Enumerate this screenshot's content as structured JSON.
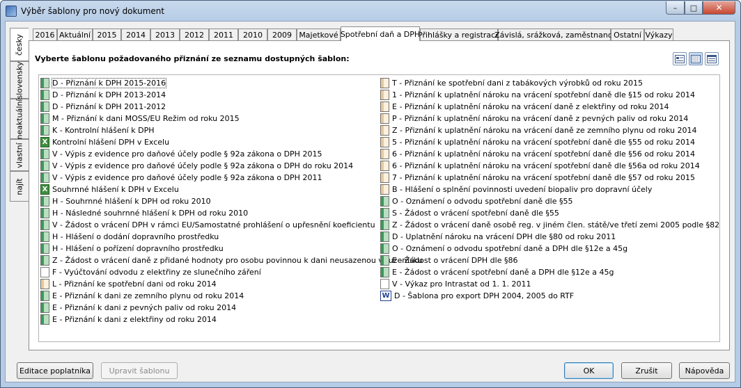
{
  "window": {
    "title": "Výběr šablony pro nový dokument",
    "min_glyph": "–",
    "max_glyph": "□",
    "close_glyph": "✕"
  },
  "side_tabs": [
    "česky",
    "slovensky",
    "neaktuální",
    "vlastní",
    "najít"
  ],
  "tabs": [
    "2016",
    "Aktuální",
    "2015",
    "2014",
    "2013",
    "2012",
    "2011",
    "2010",
    "2009",
    "Majetkové",
    "Spotřební daň a DPH",
    "Přihlášky a registrace",
    "Závislá, srážková, zaměstnanci",
    "Ostatní",
    "Výkazy"
  ],
  "prompt": "Vyberte šablonu požadovaného přiznání ze seznamu dostupných šablon:",
  "left_items": [
    {
      "label": "D - Přiznání k DPH 2015-2016",
      "icon": "green-doc-icon"
    },
    {
      "label": "D - Přiznání k DPH 2013-2014",
      "icon": "green-doc-icon"
    },
    {
      "label": "D - Přiznání k DPH 2011-2012",
      "icon": "green-doc-icon"
    },
    {
      "label": "M - Přiznání k dani MOSS/EU Režim od roku 2015",
      "icon": "green-doc-icon"
    },
    {
      "label": "K - Kontrolní hlášení k DPH",
      "icon": "green-doc-icon"
    },
    {
      "label": "Kontrolní hlášení DPH v Excelu",
      "icon": "excel-icon"
    },
    {
      "label": "V - Výpis z evidence pro daňové účely podle § 92a zákona o DPH 2015",
      "icon": "green-doc-icon"
    },
    {
      "label": "V - Výpis z evidence pro daňové účely podle § 92a zákona o DPH do roku 2014",
      "icon": "green-doc-icon"
    },
    {
      "label": "V - Výpis z evidence pro daňové účely podle § 92a zákona o DPH 2011",
      "icon": "green-doc-icon"
    },
    {
      "label": "Souhrnné hlášení k DPH v Excelu",
      "icon": "excel-icon"
    },
    {
      "label": "H - Souhrnné hlášení k DPH od roku 2010",
      "icon": "green-doc-icon"
    },
    {
      "label": "H - Následné souhrnné hlášení k DPH od roku 2010",
      "icon": "green-doc-icon"
    },
    {
      "label": "V - Žádost o vrácení DPH v rámci EU/Samostatné prohlášení o upřesnění koeficientu",
      "icon": "green-doc-icon"
    },
    {
      "label": "H - Hlášení o dodání dopravního prostředku",
      "icon": "green-doc-icon"
    },
    {
      "label": "H - Hlášení o pořízení dopravního prostředku",
      "icon": "green-doc-icon"
    },
    {
      "label": "Z - Žádost o vrácení daně z přidané hodnoty pro osobu povinnou k dani neusazenou v tuzemsku",
      "icon": "green-doc-icon"
    },
    {
      "label": "F - Vyúčtování odvodu z elektřiny ze slunečního záření",
      "icon": "white-doc-icon"
    },
    {
      "label": "L - Přiznání ke spotřební dani od roku 2014",
      "icon": "orange-doc-icon"
    },
    {
      "label": "E - Přiznání k dani ze zemního plynu od roku 2014",
      "icon": "green-doc-icon"
    },
    {
      "label": "E - Přiznání k dani z pevných paliv od roku 2014",
      "icon": "green-doc-icon"
    },
    {
      "label": "E - Přiznání k dani z elektřiny od roku 2014",
      "icon": "green-doc-icon"
    }
  ],
  "right_items": [
    {
      "label": "T - Přiznání ke spotřební dani z tabákových výrobků od roku 2015",
      "icon": "orange-doc-icon"
    },
    {
      "label": "1 - Přiznání k uplatnění nároku na vrácení spotřební daně dle §15 od roku 2014",
      "icon": "orange-doc-icon"
    },
    {
      "label": "E - Přiznání k uplatnění nároku na vrácení daně z elektřiny od roku 2014",
      "icon": "orange-doc-icon"
    },
    {
      "label": "P - Přiznání k uplatnění nároku na vrácení daně z pevných paliv od roku 2014",
      "icon": "orange-doc-icon"
    },
    {
      "label": "Z - Přiznání k uplatnění nároku na vrácení daně ze zemního plynu od roku 2014",
      "icon": "orange-doc-icon"
    },
    {
      "label": "5 - Přiznání k uplatnění nároku na vrácení spotřební daně dle §55 od roku 2014",
      "icon": "orange-doc-icon"
    },
    {
      "label": "6 - Přiznání k uplatnění nároku na vrácení spotřební daně dle §56 od roku 2014",
      "icon": "orange-doc-icon"
    },
    {
      "label": "6 - Přiznání k uplatnění nároku na vrácení spotřební daně dle §56a od roku 2014",
      "icon": "orange-doc-icon"
    },
    {
      "label": "7 - Přiznání k uplatnění nároku na vrácení spotřební daně dle §57 od roku 2015",
      "icon": "orange-doc-icon"
    },
    {
      "label": "B - Hlášení o splnění povinnosti uvedení biopaliv pro dopravní účely",
      "icon": "orange-doc-icon"
    },
    {
      "label": "O - Oznámení o odvodu spotřební daně dle §55",
      "icon": "green-doc-icon"
    },
    {
      "label": "S - Žádost o vrácení spotřební daně dle §55",
      "icon": "green-doc-icon"
    },
    {
      "label": "Z - Žádost o vrácení daně osobě reg. v jiném člen. státě/ve třetí zemi 2005 podle §82",
      "icon": "green-doc-icon"
    },
    {
      "label": "D - Uplatnění nároku na vrácení DPH dle §80 od roku 2011",
      "icon": "green-doc-icon"
    },
    {
      "label": "O - Oznámení o odvodu spotřební daně a DPH dle §12e a 45g",
      "icon": "green-doc-icon"
    },
    {
      "label": "E - Žádost o vrácení DPH dle §86",
      "icon": "green-doc-icon"
    },
    {
      "label": "E - Žádost o vrácení spotřební daně a DPH dle §12e a 45g",
      "icon": "green-doc-icon"
    },
    {
      "label": "V - Výkaz pro Intrastat od 1. 1. 2011",
      "icon": "white-doc-icon"
    },
    {
      "label": "D - Šablona pro export DPH 2004, 2005 do RTF",
      "icon": "word-doc-icon"
    }
  ],
  "buttons": {
    "edit_taxpayer": "Editace poplatníka",
    "edit_template": "Upravit šablonu",
    "ok": "OK",
    "cancel": "Zrušit",
    "help": "Nápověda"
  },
  "colors": {
    "accent": "#3c7fb1",
    "frame": "#b6cce6"
  }
}
